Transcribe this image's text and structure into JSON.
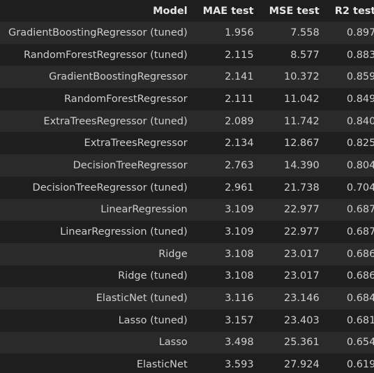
{
  "table": {
    "headers": [
      "Model",
      "MAE test",
      "MSE test",
      "R2 test"
    ],
    "rows": [
      [
        "GradientBoostingRegressor (tuned)",
        "1.956",
        "7.558",
        "0.897"
      ],
      [
        "RandomForestRegressor (tuned)",
        "2.115",
        "8.577",
        "0.883"
      ],
      [
        "GradientBoostingRegressor",
        "2.141",
        "10.372",
        "0.859"
      ],
      [
        "RandomForestRegressor",
        "2.111",
        "11.042",
        "0.849"
      ],
      [
        "ExtraTreesRegressor (tuned)",
        "2.089",
        "11.742",
        "0.840"
      ],
      [
        "ExtraTreesRegressor",
        "2.134",
        "12.867",
        "0.825"
      ],
      [
        "DecisionTreeRegressor",
        "2.763",
        "14.390",
        "0.804"
      ],
      [
        "DecisionTreeRegressor (tuned)",
        "2.961",
        "21.738",
        "0.704"
      ],
      [
        "LinearRegression",
        "3.109",
        "22.977",
        "0.687"
      ],
      [
        "LinearRegression (tuned)",
        "3.109",
        "22.977",
        "0.687"
      ],
      [
        "Ridge",
        "3.108",
        "23.017",
        "0.686"
      ],
      [
        "Ridge (tuned)",
        "3.108",
        "23.017",
        "0.686"
      ],
      [
        "ElasticNet (tuned)",
        "3.116",
        "23.146",
        "0.684"
      ],
      [
        "Lasso (tuned)",
        "3.157",
        "23.403",
        "0.681"
      ],
      [
        "Lasso",
        "3.498",
        "25.361",
        "0.654"
      ],
      [
        "ElasticNet",
        "3.593",
        "27.924",
        "0.619"
      ]
    ]
  }
}
